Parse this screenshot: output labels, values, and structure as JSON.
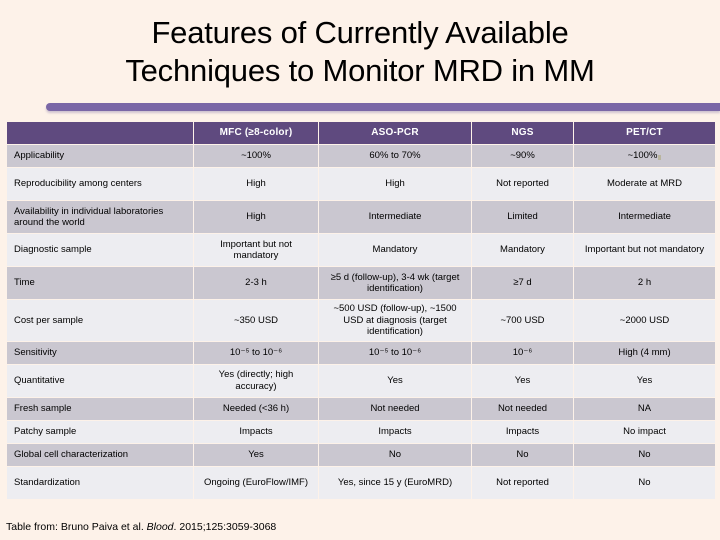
{
  "slide": {
    "title_line_1": "Features of Currently Available",
    "title_line_2": "Techniques to Monitor MRD in MM",
    "background_color": "#fdf2e9",
    "rule_color": "#7a67a6"
  },
  "table": {
    "header_bg": "#5f4a7f",
    "header_text_color": "#ffffff",
    "row_dark_bg": "#cac7d0",
    "row_light_bg": "#ededf1",
    "columns": [
      {
        "key": "feature",
        "label": ""
      },
      {
        "key": "mfc",
        "label": "MFC (≥8-color)"
      },
      {
        "key": "asopcr",
        "label": "ASO-PCR"
      },
      {
        "key": "ngs",
        "label": "NGS"
      },
      {
        "key": "petct",
        "label": "PET/CT"
      }
    ],
    "rows": [
      {
        "feature": "Applicability",
        "mfc": "~100%",
        "asopcr": "60% to 70%",
        "ngs": "~90%",
        "petct": "~100%"
      },
      {
        "feature": "Reproducibility among centers",
        "mfc": "High",
        "asopcr": "High",
        "ngs": "Not reported",
        "petct": "Moderate at MRD"
      },
      {
        "feature": "Availability in individual laboratories around the world",
        "mfc": "High",
        "asopcr": "Intermediate",
        "ngs": "Limited",
        "petct": "Intermediate"
      },
      {
        "feature": "Diagnostic sample",
        "mfc": "Important but not mandatory",
        "asopcr": "Mandatory",
        "ngs": "Mandatory",
        "petct": "Important but not mandatory"
      },
      {
        "feature": "Time",
        "mfc": "2-3 h",
        "asopcr": "≥5 d (follow-up), 3-4 wk (target identification)",
        "ngs": "≥7 d",
        "petct": "2 h"
      },
      {
        "feature": "Cost per sample",
        "mfc": "~350 USD",
        "asopcr": "~500 USD (follow-up), ~1500 USD at diagnosis (target identification)",
        "ngs": "~700 USD",
        "petct": "~2000 USD"
      },
      {
        "feature": "Sensitivity",
        "mfc": "10⁻⁵ to 10⁻⁶",
        "asopcr": "10⁻⁵ to 10⁻⁶",
        "ngs": "10⁻⁶",
        "petct": "High (4 mm)"
      },
      {
        "feature": "Quantitative",
        "mfc": "Yes (directly; high accuracy)",
        "asopcr": "Yes",
        "ngs": "Yes",
        "petct": "Yes"
      },
      {
        "feature": "Fresh sample",
        "mfc": "Needed (<36 h)",
        "asopcr": "Not needed",
        "ngs": "Not needed",
        "petct": "NA"
      },
      {
        "feature": "Patchy sample",
        "mfc": "Impacts",
        "asopcr": "Impacts",
        "ngs": "Impacts",
        "petct": "No impact"
      },
      {
        "feature": "Global cell characterization",
        "mfc": "Yes",
        "asopcr": "No",
        "ngs": "No",
        "petct": "No"
      },
      {
        "feature": "Standardization",
        "mfc": "Ongoing (EuroFlow/IMF)",
        "asopcr": "Yes, since 15 y (EuroMRD)",
        "ngs": "Not reported",
        "petct": "No"
      }
    ]
  },
  "source_note": {
    "prefix": "Table from: Bruno Paiva et al. ",
    "journal": "Blood",
    "suffix": ". 2015;125:3059-3068"
  }
}
